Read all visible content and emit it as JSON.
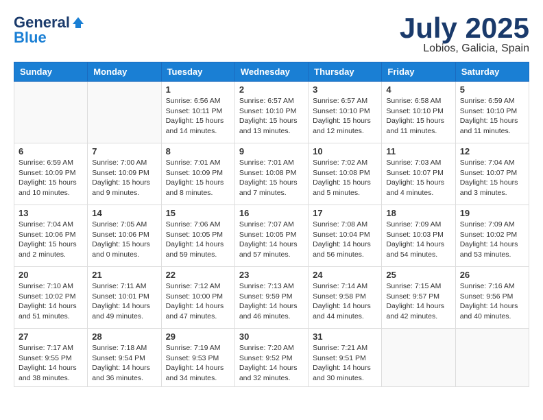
{
  "logo": {
    "general": "General",
    "blue": "Blue"
  },
  "title": {
    "month_year": "July 2025",
    "location": "Lobios, Galicia, Spain"
  },
  "weekdays": [
    "Sunday",
    "Monday",
    "Tuesday",
    "Wednesday",
    "Thursday",
    "Friday",
    "Saturday"
  ],
  "days": [
    {
      "date": null,
      "number": "",
      "sunrise": "",
      "sunset": "",
      "daylight": ""
    },
    {
      "date": null,
      "number": "",
      "sunrise": "",
      "sunset": "",
      "daylight": ""
    },
    {
      "number": "1",
      "sunrise": "Sunrise: 6:56 AM",
      "sunset": "Sunset: 10:11 PM",
      "daylight": "Daylight: 15 hours and 14 minutes."
    },
    {
      "number": "2",
      "sunrise": "Sunrise: 6:57 AM",
      "sunset": "Sunset: 10:10 PM",
      "daylight": "Daylight: 15 hours and 13 minutes."
    },
    {
      "number": "3",
      "sunrise": "Sunrise: 6:57 AM",
      "sunset": "Sunset: 10:10 PM",
      "daylight": "Daylight: 15 hours and 12 minutes."
    },
    {
      "number": "4",
      "sunrise": "Sunrise: 6:58 AM",
      "sunset": "Sunset: 10:10 PM",
      "daylight": "Daylight: 15 hours and 11 minutes."
    },
    {
      "number": "5",
      "sunrise": "Sunrise: 6:59 AM",
      "sunset": "Sunset: 10:10 PM",
      "daylight": "Daylight: 15 hours and 11 minutes."
    },
    {
      "number": "6",
      "sunrise": "Sunrise: 6:59 AM",
      "sunset": "Sunset: 10:09 PM",
      "daylight": "Daylight: 15 hours and 10 minutes."
    },
    {
      "number": "7",
      "sunrise": "Sunrise: 7:00 AM",
      "sunset": "Sunset: 10:09 PM",
      "daylight": "Daylight: 15 hours and 9 minutes."
    },
    {
      "number": "8",
      "sunrise": "Sunrise: 7:01 AM",
      "sunset": "Sunset: 10:09 PM",
      "daylight": "Daylight: 15 hours and 8 minutes."
    },
    {
      "number": "9",
      "sunrise": "Sunrise: 7:01 AM",
      "sunset": "Sunset: 10:08 PM",
      "daylight": "Daylight: 15 hours and 7 minutes."
    },
    {
      "number": "10",
      "sunrise": "Sunrise: 7:02 AM",
      "sunset": "Sunset: 10:08 PM",
      "daylight": "Daylight: 15 hours and 5 minutes."
    },
    {
      "number": "11",
      "sunrise": "Sunrise: 7:03 AM",
      "sunset": "Sunset: 10:07 PM",
      "daylight": "Daylight: 15 hours and 4 minutes."
    },
    {
      "number": "12",
      "sunrise": "Sunrise: 7:04 AM",
      "sunset": "Sunset: 10:07 PM",
      "daylight": "Daylight: 15 hours and 3 minutes."
    },
    {
      "number": "13",
      "sunrise": "Sunrise: 7:04 AM",
      "sunset": "Sunset: 10:06 PM",
      "daylight": "Daylight: 15 hours and 2 minutes."
    },
    {
      "number": "14",
      "sunrise": "Sunrise: 7:05 AM",
      "sunset": "Sunset: 10:06 PM",
      "daylight": "Daylight: 15 hours and 0 minutes."
    },
    {
      "number": "15",
      "sunrise": "Sunrise: 7:06 AM",
      "sunset": "Sunset: 10:05 PM",
      "daylight": "Daylight: 14 hours and 59 minutes."
    },
    {
      "number": "16",
      "sunrise": "Sunrise: 7:07 AM",
      "sunset": "Sunset: 10:05 PM",
      "daylight": "Daylight: 14 hours and 57 minutes."
    },
    {
      "number": "17",
      "sunrise": "Sunrise: 7:08 AM",
      "sunset": "Sunset: 10:04 PM",
      "daylight": "Daylight: 14 hours and 56 minutes."
    },
    {
      "number": "18",
      "sunrise": "Sunrise: 7:09 AM",
      "sunset": "Sunset: 10:03 PM",
      "daylight": "Daylight: 14 hours and 54 minutes."
    },
    {
      "number": "19",
      "sunrise": "Sunrise: 7:09 AM",
      "sunset": "Sunset: 10:02 PM",
      "daylight": "Daylight: 14 hours and 53 minutes."
    },
    {
      "number": "20",
      "sunrise": "Sunrise: 7:10 AM",
      "sunset": "Sunset: 10:02 PM",
      "daylight": "Daylight: 14 hours and 51 minutes."
    },
    {
      "number": "21",
      "sunrise": "Sunrise: 7:11 AM",
      "sunset": "Sunset: 10:01 PM",
      "daylight": "Daylight: 14 hours and 49 minutes."
    },
    {
      "number": "22",
      "sunrise": "Sunrise: 7:12 AM",
      "sunset": "Sunset: 10:00 PM",
      "daylight": "Daylight: 14 hours and 47 minutes."
    },
    {
      "number": "23",
      "sunrise": "Sunrise: 7:13 AM",
      "sunset": "Sunset: 9:59 PM",
      "daylight": "Daylight: 14 hours and 46 minutes."
    },
    {
      "number": "24",
      "sunrise": "Sunrise: 7:14 AM",
      "sunset": "Sunset: 9:58 PM",
      "daylight": "Daylight: 14 hours and 44 minutes."
    },
    {
      "number": "25",
      "sunrise": "Sunrise: 7:15 AM",
      "sunset": "Sunset: 9:57 PM",
      "daylight": "Daylight: 14 hours and 42 minutes."
    },
    {
      "number": "26",
      "sunrise": "Sunrise: 7:16 AM",
      "sunset": "Sunset: 9:56 PM",
      "daylight": "Daylight: 14 hours and 40 minutes."
    },
    {
      "number": "27",
      "sunrise": "Sunrise: 7:17 AM",
      "sunset": "Sunset: 9:55 PM",
      "daylight": "Daylight: 14 hours and 38 minutes."
    },
    {
      "number": "28",
      "sunrise": "Sunrise: 7:18 AM",
      "sunset": "Sunset: 9:54 PM",
      "daylight": "Daylight: 14 hours and 36 minutes."
    },
    {
      "number": "29",
      "sunrise": "Sunrise: 7:19 AM",
      "sunset": "Sunset: 9:53 PM",
      "daylight": "Daylight: 14 hours and 34 minutes."
    },
    {
      "number": "30",
      "sunrise": "Sunrise: 7:20 AM",
      "sunset": "Sunset: 9:52 PM",
      "daylight": "Daylight: 14 hours and 32 minutes."
    },
    {
      "number": "31",
      "sunrise": "Sunrise: 7:21 AM",
      "sunset": "Sunset: 9:51 PM",
      "daylight": "Daylight: 14 hours and 30 minutes."
    },
    {
      "date": null,
      "number": "",
      "sunrise": "",
      "sunset": "",
      "daylight": ""
    },
    {
      "date": null,
      "number": "",
      "sunrise": "",
      "sunset": "",
      "daylight": ""
    }
  ]
}
